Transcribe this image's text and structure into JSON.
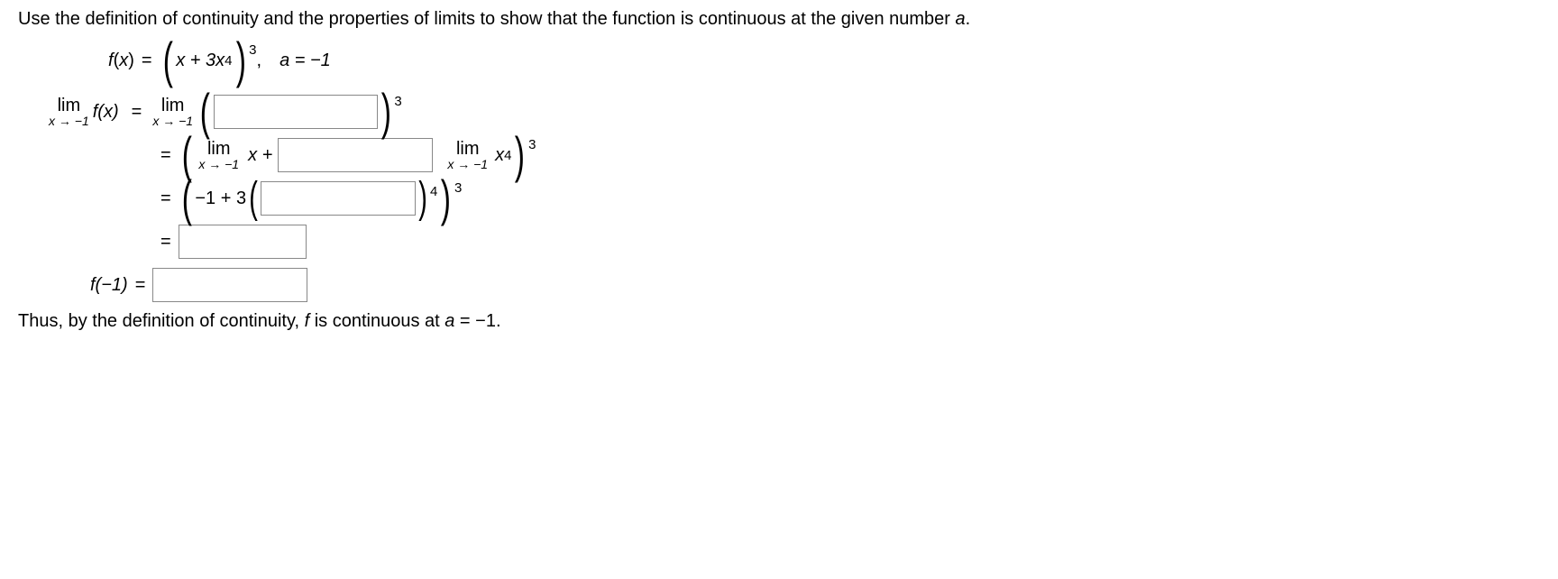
{
  "instruction": "Use the definition of continuity and the properties of limits to show that the function is continuous at the given number ",
  "instruction_a": "a",
  "instruction_end": ".",
  "func": {
    "fx": "f",
    "x": "x",
    "eq": "=",
    "lp": "(",
    "inner": "x + 3x",
    "exp4": "4",
    "rp": ")",
    "exp3": "3",
    "comma": ",",
    "a_eq": "a = −1"
  },
  "lim_label_top": "lim",
  "lim_label_bot": "x → −1",
  "line1": {
    "lhs_fx": "f(x)",
    "eq": "=",
    "lp": "(",
    "rp": ")",
    "exp": "3"
  },
  "line2": {
    "eq": "=",
    "lp": "(",
    "xplus": "x +",
    "midlim_x4": "x",
    "exp4": "4",
    "rp": ")",
    "exp": "3"
  },
  "line3": {
    "eq": "=",
    "lp": "(",
    "expr": "−1 + 3",
    "inner_lp": "(",
    "inner_rp": ")",
    "exp4": "4",
    "rp": ")",
    "exp": "3"
  },
  "line4": {
    "eq": "="
  },
  "line5": {
    "lhs": "f(−1)",
    "eq": "="
  },
  "conclude": {
    "t1": "Thus, by the definition of continuity, ",
    "f": "f",
    "t2": " is continuous at ",
    "a": "a",
    "t3": " = −1."
  }
}
